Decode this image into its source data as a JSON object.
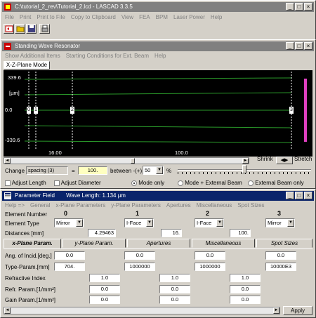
{
  "main_window": {
    "title": "C:\\tutorial_2_rev\\Tutorial_2.lcd - LASCAD 3.3.5",
    "menu": [
      "File",
      "Print",
      "Print to File",
      "Copy to Clipboard",
      "View",
      "FEA",
      "BPM",
      "Laser Power",
      "Help"
    ]
  },
  "title_buttons": {
    "minimize": "_",
    "maximize": "□",
    "close": "×"
  },
  "toolbar_icons": [
    "refresh-icon",
    "open-folder-icon",
    "save-icon",
    "print-icon"
  ],
  "resonator": {
    "title": "Standing Wave Resonator",
    "menu": [
      "Show Additional Items",
      "Starting Conditions for Ext. Beam",
      "Help"
    ],
    "mode_label": "X-Z-Plane Mode",
    "plot": {
      "y_top": "339.6",
      "y_unit": "[µm]",
      "y_zero": "0.0",
      "y_bottom": "-339.6",
      "markers": [
        "0",
        "1",
        "2",
        "3"
      ],
      "dist_a": "16.00",
      "dist_b": "100.0"
    },
    "shrink_label": "Shrink",
    "stretch_label": "Stretch",
    "change_label": "Change",
    "change_param": "spacing   (3)",
    "equals": "=",
    "change_value": "100.",
    "between_label": "between -(+)",
    "percent_value": "50",
    "percent_sign": "%",
    "adjust_length": "Adjust Length",
    "adjust_diameter": "Adjust Diameter",
    "mode_options": [
      "Mode only",
      "Mode + External Beam",
      "External Beam only"
    ],
    "mode_selected": 0
  },
  "param_field": {
    "title": "Parameter Field",
    "wavelength": "Wave Length: 1.134  µm",
    "menu": [
      "Help =>",
      "General",
      "x-Plane Parameters",
      "y-Plane Parameters",
      "Apertures",
      "Miscellaneous",
      "Spot Sizes"
    ],
    "element_number_label": "Element Number",
    "element_type_label": "Element Type",
    "distances_label": "Distances [mm]",
    "elements": [
      {
        "num": "0",
        "type": "Mirror"
      },
      {
        "num": "1",
        "type": "I-Face"
      },
      {
        "num": "2",
        "type": "I-Face"
      },
      {
        "num": "3",
        "type": "Mirror"
      }
    ],
    "distances": [
      "4.29463",
      "16.",
      "100."
    ],
    "tabs": [
      "x-Plane Param.",
      "y-Plane Param.",
      "Apertures",
      "Miscellaneous",
      "Spot Sizes"
    ],
    "rows": [
      {
        "label": "Ang. of Incid.[deg.]",
        "values": [
          "0.0",
          "0.0",
          "0.0",
          "0.0"
        ]
      },
      {
        "label": "Type-Param.[mm]",
        "values": [
          "704.",
          "1000000",
          "1000000",
          "10000E3"
        ]
      }
    ],
    "medium_rows": [
      {
        "label": "Refractive Index",
        "values": [
          "1.0",
          "1.0",
          "1.0"
        ]
      },
      {
        "label": "Refr. Param.[1/mm²]",
        "values": [
          "0.0",
          "0.0",
          "0.0"
        ]
      },
      {
        "label": "Gain Param.[1/mm²]",
        "values": [
          "0.0",
          "0.0",
          "0.0"
        ]
      }
    ],
    "apply_label": "Apply"
  }
}
